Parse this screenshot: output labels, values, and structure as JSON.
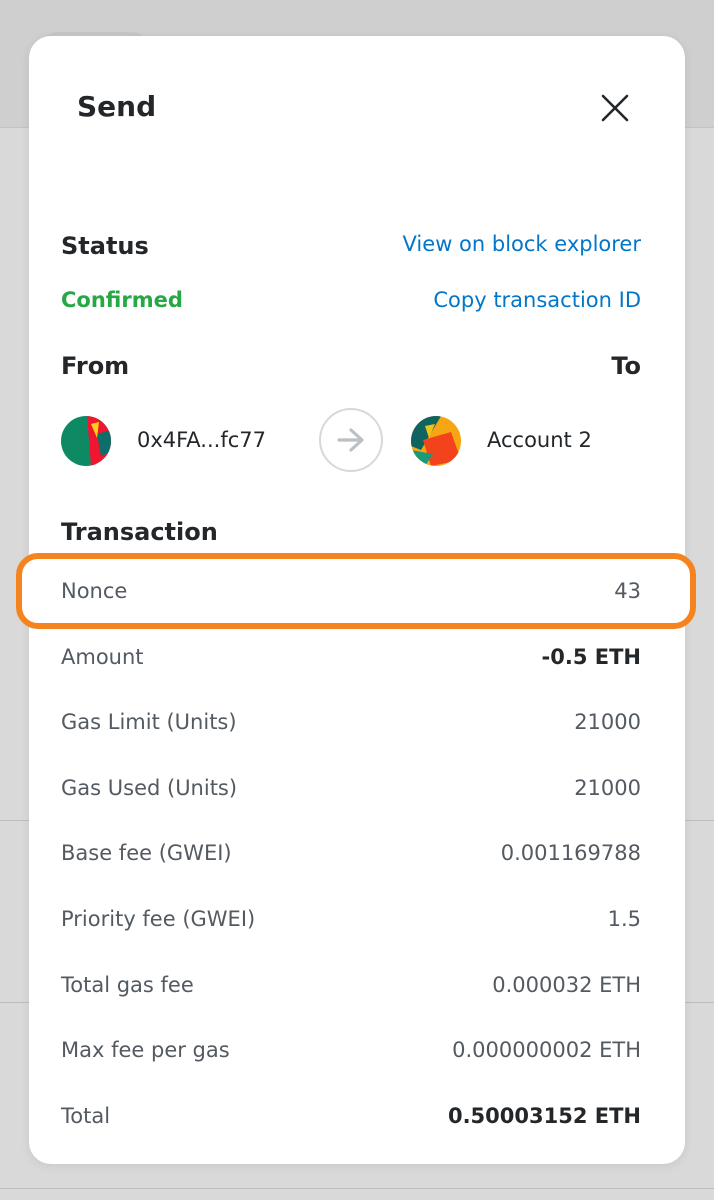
{
  "modal": {
    "title": "Send",
    "close_icon": "close-icon"
  },
  "status": {
    "label": "Status",
    "value": "Confirmed",
    "value_color": "#28a745",
    "view_link": "View on block explorer",
    "copy_link": "Copy transaction ID"
  },
  "transfer": {
    "from_label": "From",
    "to_label": "To",
    "from_address": "0x4FA...fc77",
    "to_name": "Account 2",
    "arrow_icon": "arrow-right-icon"
  },
  "transaction": {
    "label": "Transaction",
    "rows": [
      {
        "label": "Nonce",
        "value": "43"
      },
      {
        "label": "Amount",
        "value": "-0.5 ETH"
      },
      {
        "label": "Gas Limit (Units)",
        "value": "21000"
      },
      {
        "label": "Gas Used (Units)",
        "value": "21000"
      },
      {
        "label": "Base fee (GWEI)",
        "value": "0.001169788"
      },
      {
        "label": "Priority fee (GWEI)",
        "value": "1.5"
      },
      {
        "label": "Total gas fee",
        "value": "0.000032 ETH"
      },
      {
        "label": "Max fee per gas",
        "value": "0.000000002 ETH"
      },
      {
        "label": "Total",
        "value": "0.50003152 ETH"
      }
    ]
  },
  "colors": {
    "link": "#0376c9",
    "highlight": "#f5841f",
    "text": "#24272a",
    "muted": "#535a61"
  }
}
